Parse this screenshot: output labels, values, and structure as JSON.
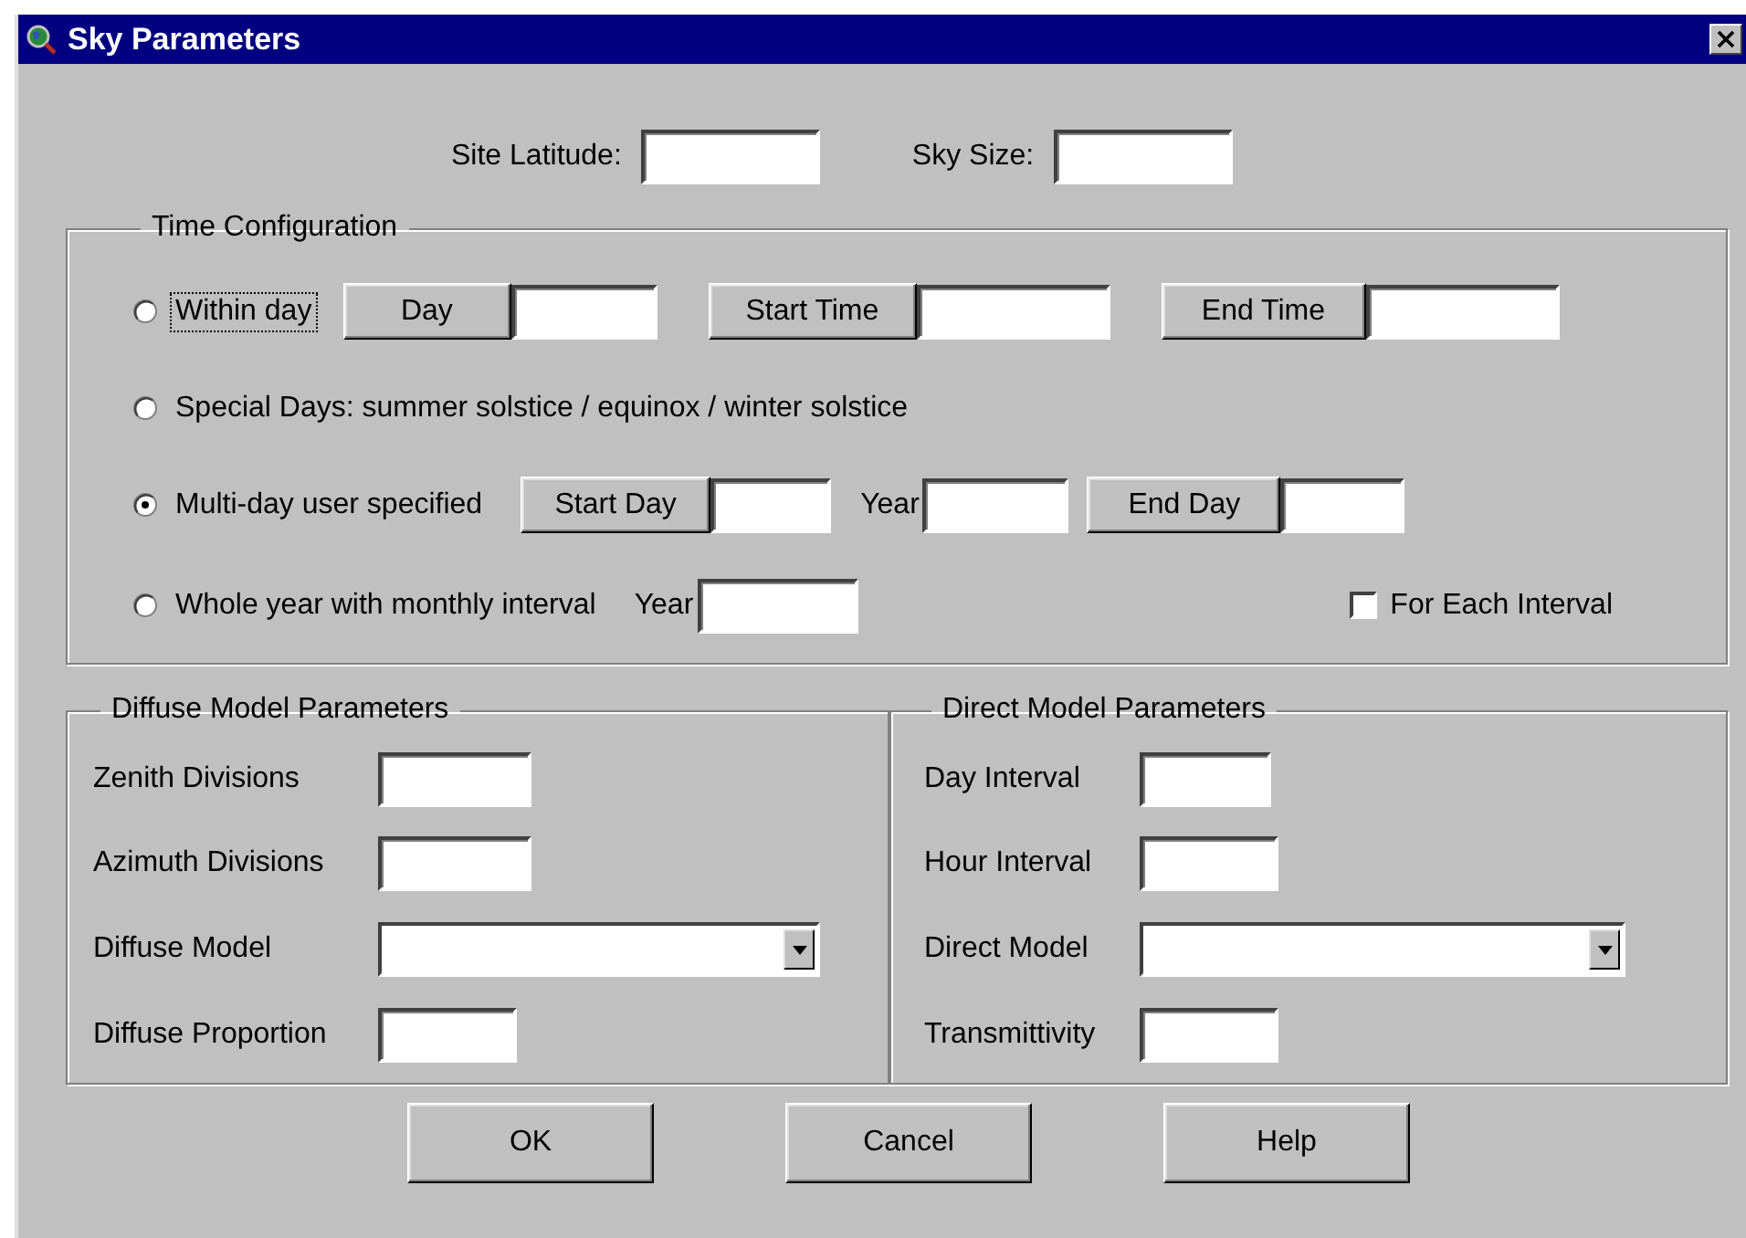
{
  "window": {
    "title": "Sky Parameters"
  },
  "top_fields": [
    {
      "label": "Site Latitude:"
    },
    {
      "label": "Sky Size:"
    }
  ],
  "time_configuration": {
    "title": "Time Configuration",
    "options": [
      {
        "label": "Within day",
        "selected": false,
        "focused": true,
        "controls": [
          {
            "kind": "button",
            "label": "Day"
          },
          {
            "kind": "field"
          },
          {
            "kind": "button",
            "label": "Start Time"
          },
          {
            "kind": "field"
          },
          {
            "kind": "button",
            "label": "End Time"
          },
          {
            "kind": "field"
          }
        ]
      },
      {
        "label": "Special Days: summer solstice / equinox / winter solstice",
        "selected": false,
        "focused": false
      },
      {
        "label": "Multi-day user specified",
        "selected": true,
        "focused": false,
        "controls": [
          {
            "kind": "button",
            "label": "Start Day"
          },
          {
            "kind": "field"
          },
          {
            "kind": "label",
            "label": "Year"
          },
          {
            "kind": "field"
          },
          {
            "kind": "button",
            "label": "End Day"
          },
          {
            "kind": "field"
          }
        ]
      },
      {
        "label": "Whole year with monthly interval",
        "selected": false,
        "focused": false,
        "controls": [
          {
            "kind": "label",
            "label": "Year"
          },
          {
            "kind": "field"
          },
          {
            "kind": "checkbox",
            "label": "For Each Interval",
            "checked": false
          }
        ]
      }
    ]
  },
  "diffuse_model_parameters": {
    "title": "Diffuse Model Parameters",
    "rows": [
      {
        "label": "Zenith Divisions",
        "kind": "field"
      },
      {
        "label": "Azimuth Divisions",
        "kind": "field"
      },
      {
        "label": "Diffuse Model",
        "kind": "dropdown"
      },
      {
        "label": "Diffuse Proportion",
        "kind": "field"
      }
    ]
  },
  "direct_model_parameters": {
    "title": "Direct Model Parameters",
    "rows": [
      {
        "label": "Day Interval",
        "kind": "field"
      },
      {
        "label": "Hour Interval",
        "kind": "field"
      },
      {
        "label": "Direct Model",
        "kind": "dropdown"
      },
      {
        "label": "Transmittivity",
        "kind": "field"
      }
    ]
  },
  "buttons": [
    "OK",
    "Cancel",
    "Help"
  ]
}
